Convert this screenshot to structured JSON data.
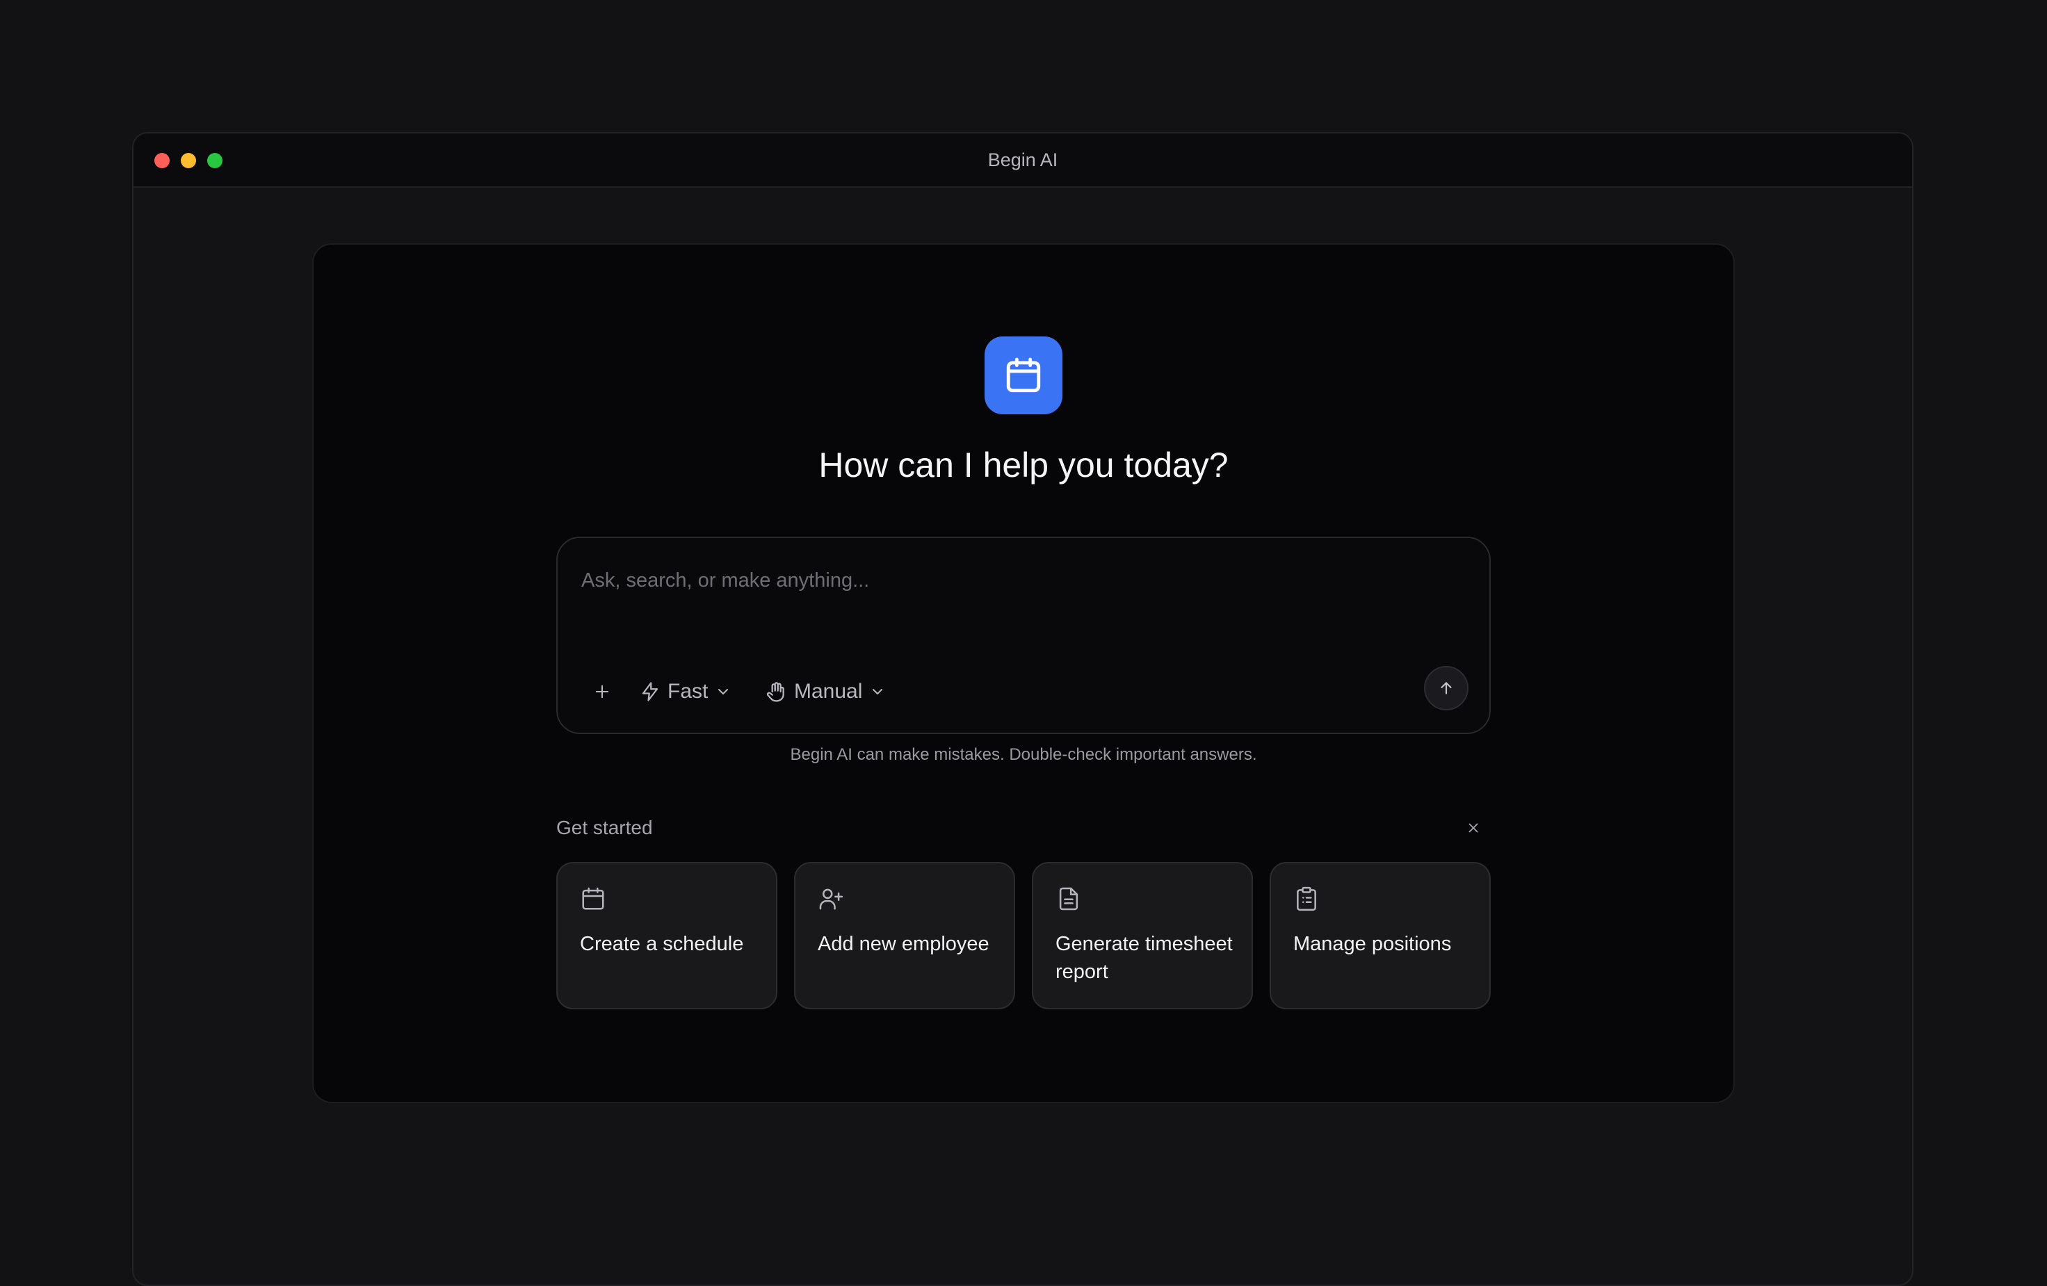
{
  "window": {
    "title": "Begin AI"
  },
  "hero": {
    "app_icon": "calendar-icon",
    "accent_color": "#3b73f5",
    "headline": "How can I help you today?"
  },
  "composer": {
    "placeholder": "Ask, search, or make anything...",
    "value": "",
    "add_icon": "plus-icon",
    "speed_label": "Fast",
    "speed_icon": "lightning-icon",
    "mode_label": "Manual",
    "mode_icon": "hand-icon",
    "send_icon": "arrow-up-icon"
  },
  "disclaimer": "Begin AI can make mistakes. Double-check important answers.",
  "get_started": {
    "label": "Get started",
    "close_icon": "close-icon",
    "cards": [
      {
        "icon": "calendar-icon",
        "label": "Create a schedule"
      },
      {
        "icon": "user-plus-icon",
        "label": "Add new employee"
      },
      {
        "icon": "document-icon",
        "label": "Generate timesheet report"
      },
      {
        "icon": "clipboard-list-icon",
        "label": "Manage positions"
      }
    ]
  }
}
